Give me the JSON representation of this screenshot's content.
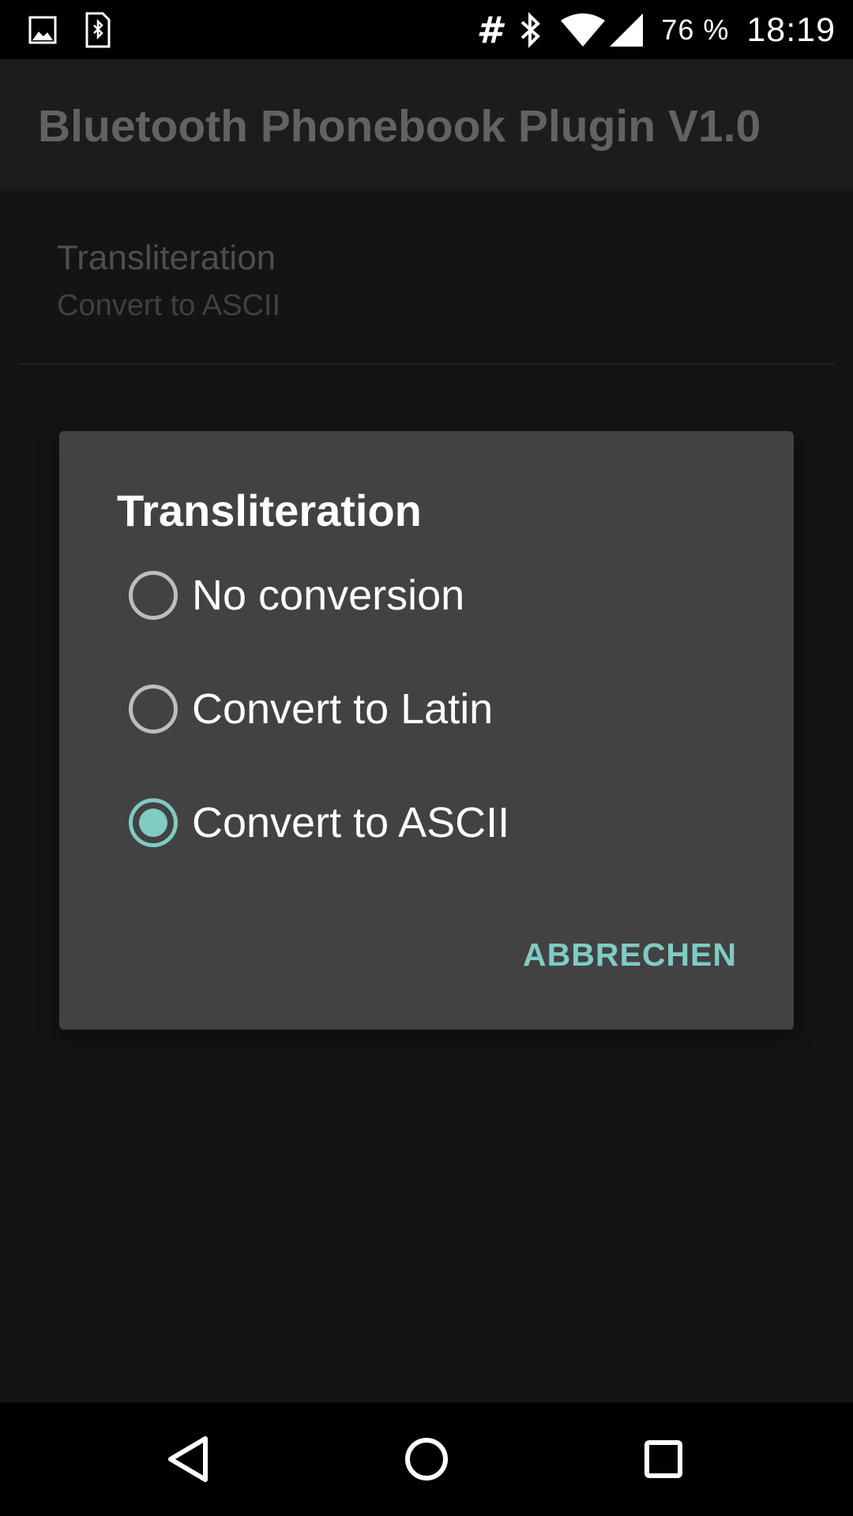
{
  "status_bar": {
    "left_icons": [
      "image-notification-icon",
      "sim-bluetooth-icon"
    ],
    "hash_symbol": "#",
    "right_icons": [
      "bluetooth-icon",
      "wifi-icon",
      "cell-signal-icon"
    ],
    "battery": "76 %",
    "time": "18:19"
  },
  "app": {
    "title": "Bluetooth Phonebook Plugin V1.0",
    "preference": {
      "title": "Transliteration",
      "summary": "Convert to ASCII"
    }
  },
  "dialog": {
    "title": "Transliteration",
    "options": [
      {
        "label": "No conversion",
        "selected": false
      },
      {
        "label": "Convert to Latin",
        "selected": false
      },
      {
        "label": "Convert to ASCII",
        "selected": true
      }
    ],
    "cancel_label": "ABBRECHEN"
  },
  "nav_bar": {
    "icons": [
      "back-icon",
      "home-icon",
      "recent-apps-icon"
    ]
  },
  "colors": {
    "accent": "#80cbc4",
    "dialog_background": "#424242",
    "app_background": "#141414"
  }
}
